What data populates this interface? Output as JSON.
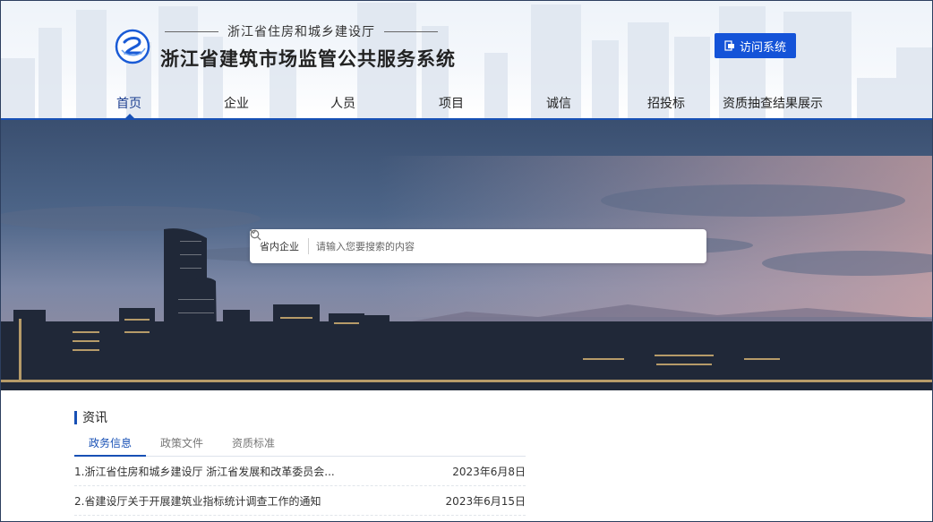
{
  "header": {
    "sub_org": "浙江省住房和城乡建设厅",
    "title": "浙江省建筑市场监管公共服务系统",
    "visit_button": "访问系统"
  },
  "nav": [
    {
      "label": "首页",
      "active": true
    },
    {
      "label": "企业"
    },
    {
      "label": "人员"
    },
    {
      "label": "项目"
    },
    {
      "label": "诚信"
    },
    {
      "label": "招投标"
    },
    {
      "label": "资质抽查结果展示"
    }
  ],
  "search": {
    "scope": "省内企业",
    "placeholder": "请输入您要搜索的内容"
  },
  "news": {
    "section_title": "资讯",
    "tabs": [
      {
        "label": "政务信息",
        "active": true
      },
      {
        "label": "政策文件"
      },
      {
        "label": "资质标准"
      }
    ],
    "items": [
      {
        "title": "1.浙江省住房和城乡建设厅 浙江省发展和改革委员会...",
        "date": "2023年6月8日"
      },
      {
        "title": "2.省建设厅关于开展建筑业指标统计调查工作的通知",
        "date": "2023年6月15日"
      }
    ]
  },
  "colors": {
    "accent": "#1750b5",
    "button": "#1453d8"
  },
  "icons": {
    "logo": "ring-logo-icon",
    "visit": "login-icon",
    "scope": "chevron-down-icon",
    "search": "search-icon"
  }
}
